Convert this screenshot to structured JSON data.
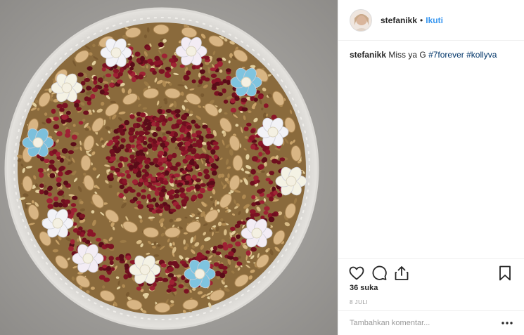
{
  "header": {
    "username": "stefanikk",
    "separator": "•",
    "follow_label": "Ikuti",
    "avatar_icon": "avatar-photo"
  },
  "caption": {
    "username": "stefanikk",
    "text": "Miss ya G",
    "hashtags": [
      "#7forever",
      "#kollyva"
    ]
  },
  "actions": {
    "like_icon": "heart-icon",
    "comment_icon": "comment-icon",
    "share_icon": "share-icon",
    "save_icon": "bookmark-icon"
  },
  "likes_label": "36 suka",
  "date_label": "8 JULI",
  "comment": {
    "placeholder": "Tambahkan komentar...",
    "more_icon": "more-options-icon"
  },
  "media": {
    "description_icon": "kollyva-dish-photo"
  },
  "colors": {
    "link": "#3897f0",
    "hashtag": "#003569",
    "text": "#262626",
    "muted": "#999999",
    "border": "#efefef"
  }
}
